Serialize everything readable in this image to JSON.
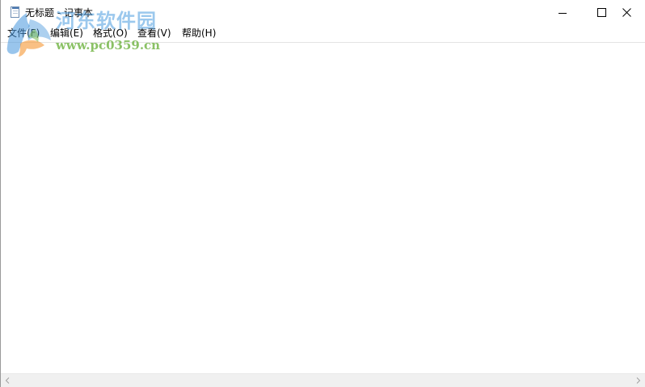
{
  "window": {
    "title": "无标题 - 记事本"
  },
  "menu": {
    "items": [
      {
        "label": "文件(F)"
      },
      {
        "label": "编辑(E)"
      },
      {
        "label": "格式(O)"
      },
      {
        "label": "查看(V)"
      },
      {
        "label": "帮助(H)"
      }
    ]
  },
  "editor": {
    "content": ""
  },
  "watermark": {
    "name": "河东软件园",
    "url": "www.pc0359.cn"
  },
  "icons": {
    "app": "notepad-icon",
    "minimize": "minimize-icon",
    "maximize": "maximize-icon",
    "close": "close-icon",
    "scroll_left": "chevron-left-icon",
    "scroll_right": "chevron-right-icon"
  }
}
